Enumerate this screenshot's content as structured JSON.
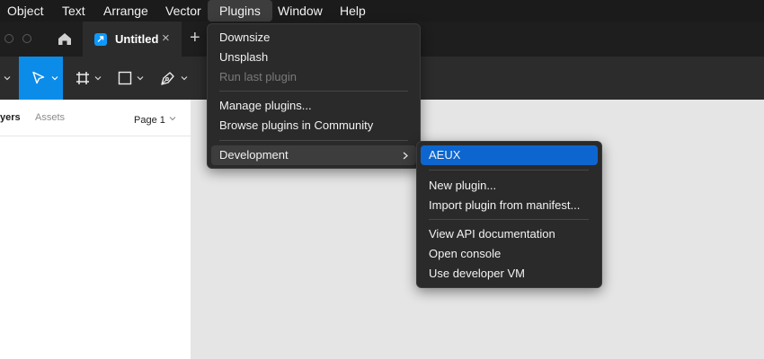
{
  "menubar": {
    "items": [
      "Object",
      "Text",
      "Arrange",
      "Vector",
      "Plugins",
      "Window",
      "Help"
    ],
    "active": "Plugins"
  },
  "tabs": {
    "document_title": "Untitled",
    "close_glyph": "×",
    "new_tab_glyph": "+"
  },
  "left_panel": {
    "layers_tab": "yers",
    "assets_tab": "Assets",
    "page_selector": "Page 1"
  },
  "plugins_menu": {
    "items": [
      {
        "label": "Downsize",
        "enabled": true
      },
      {
        "label": "Unsplash",
        "enabled": true
      },
      {
        "label": "Run last plugin",
        "enabled": false
      },
      {
        "label": "Manage plugins...",
        "enabled": true
      },
      {
        "label": "Browse plugins in Community",
        "enabled": true
      },
      {
        "label": "Development",
        "enabled": true,
        "has_submenu": true,
        "highlighted": true
      }
    ]
  },
  "development_menu": {
    "items": [
      {
        "label": "AEUX",
        "selected": true
      },
      {
        "label": "New plugin..."
      },
      {
        "label": "Import plugin from manifest..."
      },
      {
        "label": "View API documentation"
      },
      {
        "label": "Open console"
      },
      {
        "label": "Use developer VM"
      }
    ]
  },
  "colors": {
    "accent": "#0c8ce9",
    "menu_selected": "#0d66d0",
    "menu_bg": "#2a2a2a",
    "menubar_bg": "#1b1b1b",
    "toolbar_bg": "#2c2c2c",
    "canvas_bg": "#e5e5e5"
  },
  "icons": [
    "home-icon",
    "figma-file-icon",
    "move-tool-icon",
    "frame-tool-icon",
    "shape-tool-icon",
    "pen-tool-icon",
    "chevron-down-icon",
    "chevron-right-icon"
  ]
}
